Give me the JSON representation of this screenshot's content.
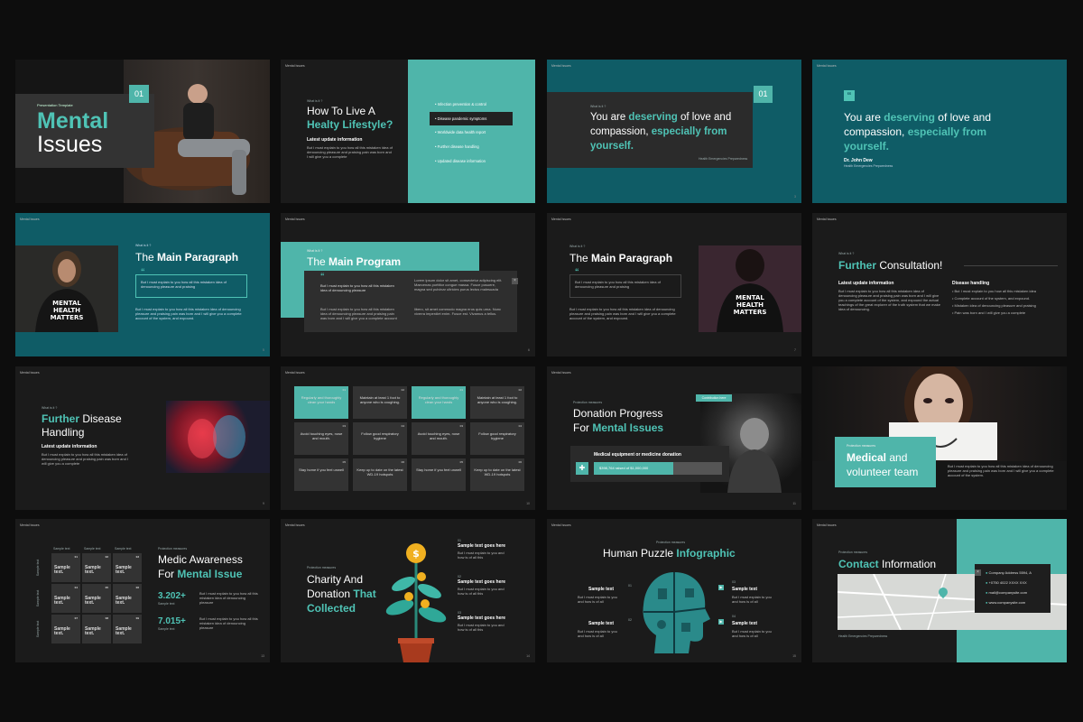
{
  "brand": "Mental Issues",
  "s1": {
    "tag": "Presentation Template",
    "title1": "Mental",
    "title2": "Issues",
    "num": "01"
  },
  "s2": {
    "what": "What is it ?",
    "title1": "How To Live A",
    "title2": "Healty Lifestyle?",
    "sub": "Latest update information",
    "body": "But I must explain to you how all this mistaken idea of denouncing pleasure and praising pain was born and I will give you a complete",
    "items": [
      "Infection prevention & control",
      "Disease pandemic symptoms",
      "Worldwide data health report",
      "Further disease handling",
      "Updated disease information"
    ]
  },
  "s3": {
    "what": "What is it ?",
    "l1a": "You are ",
    "l1b": "deserving",
    "l1c": " of love and",
    "l2a": "compassion, ",
    "l2b": "especially from",
    "l3": "yourself.",
    "cap": "Health Emergencies Preparedness",
    "num": "01"
  },
  "s4": {
    "l1a": "You are ",
    "l1b": "deserving",
    "l1c": " of love and",
    "l2a": "compassion, ",
    "l2b": "especially from",
    "l3": "yourself.",
    "author": "Dr. John Dew",
    "cap": "Health Emergencies Preparedness"
  },
  "s5": {
    "what": "What is it ?",
    "title1": "The ",
    "title2": "Main Paragraph",
    "quote": "But I must explain to you how all this mistaken idea of denouncing pleasure and praising",
    "body": "But I must explain to you how all this mistaken idea of denouncing pleasure and praising pain was born and I will give you a complete account of the system, and expound."
  },
  "s6": {
    "what": "What is it ?",
    "title1": "The ",
    "title2": "Main Program",
    "quote": "But I must explain to you how all this mistaken idea of denouncing pleasure",
    "body1": "But I must explain to you how all this mistaken idea of denouncing pleasure and praising pain was born and I will give you a complete account",
    "body2": "Lorem ipsum dolor sit amet, consectetur adipiscing elit. Maecenas porttitor congue massa. Fusce posuere, magna sed pulvinar ultricies purus lectus malesuada",
    "body3": "libero, sit amet commodo magna eros quis urna. Nunc viverra imperdiet enim. Fusce est. Vivamus a tellus."
  },
  "s7": {
    "what": "What is it ?",
    "title1": "The ",
    "title2": "Main Paragraph",
    "quote": "But I must explain to you how all this mistaken idea of denouncing pleasure and praising",
    "body": "But I must explain to you how all this mistaken idea of denouncing pleasure and praising pain was born and I will give you a complete account of the system, and expound."
  },
  "s8": {
    "what": "What is it ?",
    "title1": "Further",
    "title2": " Consultation!",
    "h1": "Latest update information",
    "b1": "But I must explain to you how all this mistaken idea of denouncing pleasure and praising pain was born and I will give you a complete account of the system, and expound the actual teachings of the great explorer of the truth system that we make idea of denouncing.",
    "h2": "Disease handling",
    "items": [
      "But I must explain to you how all this mistaken idea",
      "Complete account of the system, and expound.",
      "Mistaken idea of denouncing pleasure and praising",
      "Pain was born and I will give you a complete"
    ]
  },
  "s9": {
    "what": "What is it ?",
    "title1": "Further",
    "title2": " Disease",
    "title3": "Handling",
    "sub": "Latest update information",
    "body": "But I must explain to you how all this mistaken idea of denouncing pleasure and praising pain was born and I will give you a complete"
  },
  "s10": {
    "cells": [
      {
        "n": "01",
        "t": "Regularly and thoroughly clean your hands"
      },
      {
        "n": "02",
        "t": "Maintain at least 1 foot to anyone who is coughing."
      },
      {
        "n": "01",
        "t": "Regularly and thoroughly clean your hands"
      },
      {
        "n": "02",
        "t": "Maintain at least 1 foot to anyone who is coughing."
      },
      {
        "n": "03",
        "t": "Avoid touching eyes, nose and mouth."
      },
      {
        "n": "04",
        "t": "Follow good respiratory hygiene"
      },
      {
        "n": "03",
        "t": "Avoid touching eyes, nose and mouth."
      },
      {
        "n": "04",
        "t": "Follow good respiratory hygiene"
      },
      {
        "n": "05",
        "t": "Stay home if you feel unwell"
      },
      {
        "n": "06",
        "t": "Keep up to date on the latest WD-19 hotspots"
      },
      {
        "n": "05",
        "t": "Stay home if you feel unwell"
      },
      {
        "n": "06",
        "t": "Keep up to date on the latest WD-19 hotspots"
      }
    ]
  },
  "s11": {
    "tag": "Protection measures",
    "title1": "Donation Progress",
    "title2a": "For ",
    "title2b": "Mental Issues",
    "btn": "Contribution here",
    "bar_label": "Medical equipment or medicine donation",
    "bar_text": "$398,764 raised of $1,000,000",
    "progress": 0.62
  },
  "s12": {
    "tag": "Protection measures",
    "title1": "Medical",
    "title2": " and",
    "title3": "volunteer team",
    "body": "But I must explain to you how all this mistaken idea of denouncing pleasure and praising pain was born and I will give you a complete account of the system."
  },
  "s13": {
    "tag": "Protection measures",
    "title1": "Medic Awareness",
    "title2a": "For ",
    "title2b": "Mental Issue",
    "stat1": "3.202+",
    "stat1s": "Sample text",
    "stat1b": "But I must explain to you how all this mistaken idea of denouncing pleasure",
    "stat2": "7.015+",
    "stat2s": "Sample text",
    "stat2b": "But I must explain to you how all this mistaken idea of denouncing pleasure",
    "colhead": "Sample text",
    "rowhead": "Sample text",
    "cell": "Sample text.",
    "nums": [
      "01",
      "02",
      "03",
      "04",
      "05",
      "06",
      "07",
      "08",
      "09"
    ]
  },
  "s14": {
    "tag": "Protection measures",
    "title1": "Charity And",
    "title2a": "Donation ",
    "title2b": "That",
    "title3": "Collected",
    "items": [
      {
        "n": "01",
        "h": "Sample text goes here",
        "b": "But I must explain to you and how is of all this"
      },
      {
        "n": "02",
        "h": "Sample text goes here",
        "b": "But I must explain to you and how is of all this"
      },
      {
        "n": "03",
        "h": "Sample text goes here",
        "b": "But I must explain to you and how is of all this"
      }
    ]
  },
  "s15": {
    "tag": "Protection measures",
    "title1": "Human Puzzle ",
    "title2": "Infographic",
    "label": "Sample text",
    "body": "But I must explain to you and how is of all",
    "nums": [
      "01",
      "02",
      "03",
      "04"
    ]
  },
  "s16": {
    "tag": "Protection measures",
    "title1": "Contact",
    "title2": " Information",
    "items": [
      "Company Address 5594, A",
      "+0750 4022 XXXX XXX",
      "mail@companysite.com",
      "www.companysite.com"
    ],
    "cap": "Health Emergencies Preparedness"
  },
  "colors": {
    "teal": "#4fb5aa",
    "accent": "#4fc3b5",
    "dark_teal": "#0f5c66",
    "slide_bg": "#1b1b1b"
  }
}
